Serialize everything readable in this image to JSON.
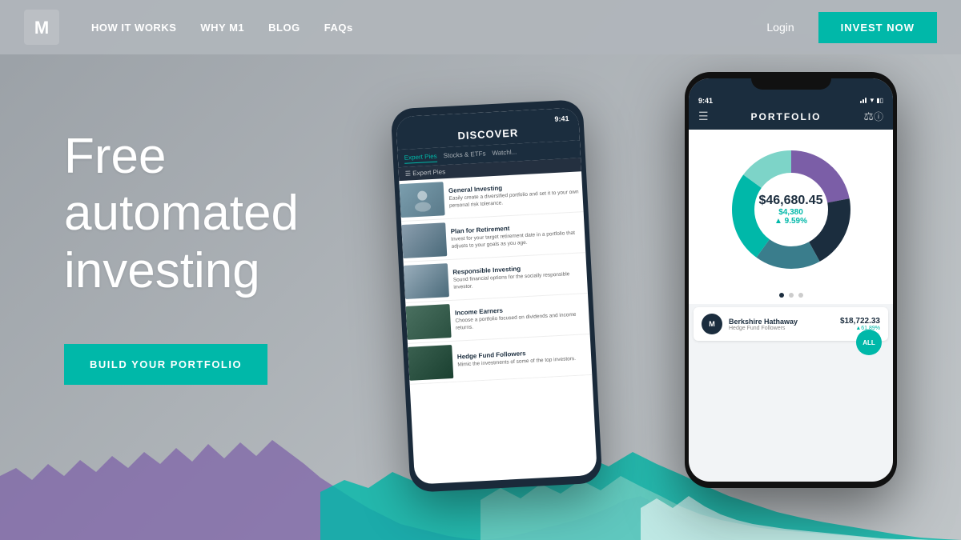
{
  "nav": {
    "logo_text": "M",
    "links": [
      {
        "id": "how-it-works",
        "label": "HOW IT WORKS"
      },
      {
        "id": "why-m1",
        "label": "WHY M1"
      },
      {
        "id": "blog",
        "label": "BLOG"
      },
      {
        "id": "faqs",
        "label": "FAQs"
      }
    ],
    "login_label": "Login",
    "invest_label": "INVEST NOW"
  },
  "hero": {
    "headline_line1": "Free",
    "headline_line2": "automated",
    "headline_line3": "investing",
    "cta_label": "BUILD YOUR PORTFOLIO"
  },
  "phone_discover": {
    "time": "9:41",
    "title": "DISCOVER",
    "tabs": [
      "Expert Pies",
      "Stocks & ETFs",
      "Watchl..."
    ],
    "items": [
      {
        "title": "General Investing",
        "description": "Easily create a diversified portfolio and set it to your own personal risk tolerance.",
        "color": "#7b9eae"
      },
      {
        "title": "Plan for Retirement",
        "description": "Invest for your target retirement date in a portfolio that adjusts to your goals as you age.",
        "color": "#5a7a8a"
      },
      {
        "title": "Responsible Investing",
        "description": "Sound financial options for the socially responsible investor.",
        "color": "#6a8090"
      },
      {
        "title": "Income Earners",
        "description": "Choose a portfolio focused on dividends and income returns.",
        "color": "#4a7060"
      },
      {
        "title": "Hedge Fund Followers",
        "description": "Mimic the investments of some of the top investors.",
        "color": "#3a6050"
      }
    ]
  },
  "phone_portfolio": {
    "time": "9:41",
    "title": "PORTFOLIO",
    "portfolio_value": "$46,680.45",
    "portfolio_gain": "$4,380",
    "portfolio_pct": "▲ 9.59%",
    "all_label": "ALL",
    "holdings": [
      {
        "symbol": "M",
        "name": "Berkshire Hathaway",
        "subtitle": "Hedge Fund Followers",
        "value": "$18,722.33",
        "change": "▲61.89%"
      }
    ],
    "chart": {
      "segments": [
        {
          "color": "#7b5ea7",
          "pct": 22
        },
        {
          "color": "#1b2d3e",
          "pct": 20
        },
        {
          "color": "#3a7d8c",
          "pct": 18
        },
        {
          "color": "#00b8a9",
          "pct": 25
        },
        {
          "color": "#7dd4c8",
          "pct": 15
        }
      ]
    }
  }
}
